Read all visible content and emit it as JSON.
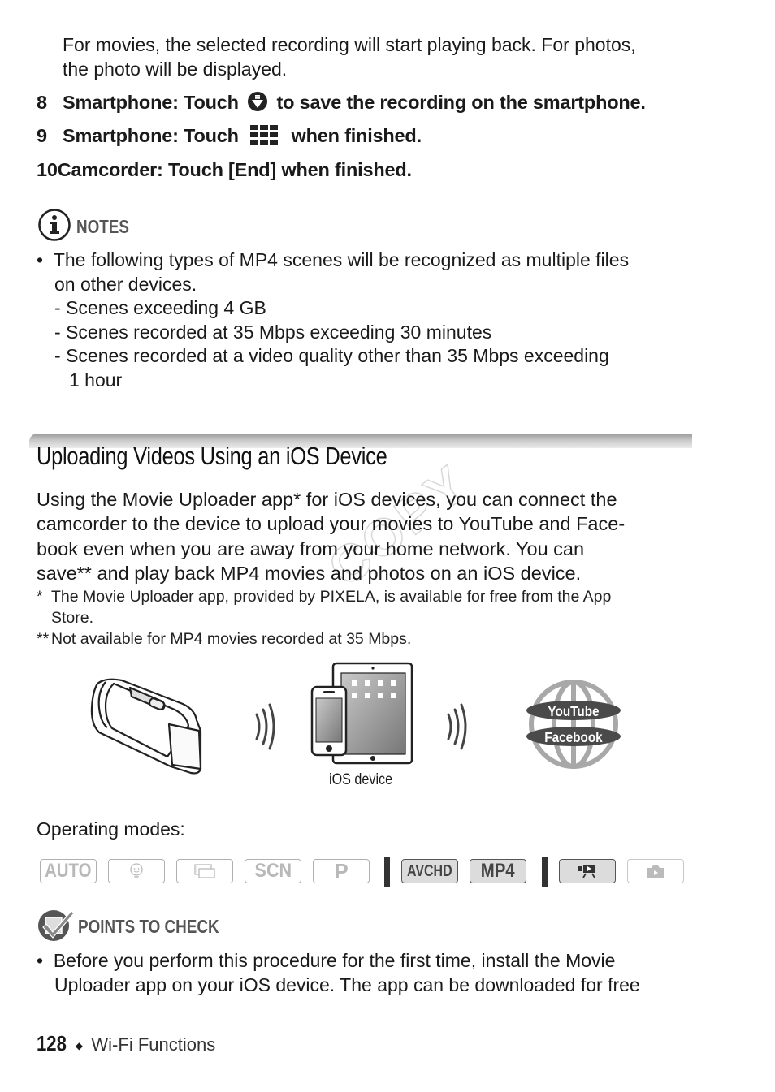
{
  "intro": {
    "line1": "For movies, the selected recording will start playing back. For photos,",
    "line2": "the photo will be displayed."
  },
  "steps": [
    {
      "num": "8",
      "before": "Smartphone: Touch",
      "icon": "save-download-icon",
      "after": "to save the recording on the smartphone."
    },
    {
      "num": "9",
      "before": "Smartphone: Touch",
      "icon": "grid-menu-icon",
      "after": "when finished."
    },
    {
      "num": "10",
      "before": "Camcorder: Touch [End] when finished.",
      "icon": "",
      "after": ""
    }
  ],
  "notes": {
    "heading": "NOTES",
    "bullet": "The following types of MP4 scenes will be recognized as multiple files",
    "bullet_cont": "on other devices.",
    "subitems": [
      "Scenes exceeding 4 GB",
      "Scenes recorded at 35 Mbps exceeding 30 minutes",
      "Scenes recorded at a video quality other than 35 Mbps exceeding"
    ],
    "subitem_cont": "1 hour"
  },
  "section": {
    "title": "Uploading Videos Using an iOS Device",
    "paragraph": [
      "Using the Movie Uploader app* for iOS devices, you can connect the",
      "camcorder to the device to upload your movies to YouTube and Face-",
      "book even when you are away from your home network. You can",
      "save** and play back MP4 movies and photos on an iOS device."
    ],
    "footnotes": [
      {
        "mark": "*",
        "text": "The Movie Uploader app, provided by PIXELA, is available for free from the App",
        "cont": "Store."
      },
      {
        "mark": "**",
        "text": "Not available for MP4 movies recorded at 35 Mbps.",
        "cont": ""
      }
    ],
    "watermark": "COPY"
  },
  "illustration": {
    "ios_label": "iOS device",
    "service1": "YouTube",
    "service2": "Facebook"
  },
  "operating_modes": {
    "label": "Operating modes:",
    "modes": [
      {
        "name": "AUTO",
        "active": false
      },
      {
        "name": "baby-mode",
        "active": false
      },
      {
        "name": "cinema-mode",
        "active": false
      },
      {
        "name": "SCN",
        "active": false
      },
      {
        "name": "P",
        "active": false
      },
      {
        "name": "AVCHD",
        "active": true
      },
      {
        "name": "MP4",
        "active": true
      },
      {
        "name": "movie-playback",
        "active": true
      },
      {
        "name": "photo-playback",
        "active": false
      }
    ]
  },
  "points_to_check": {
    "heading": "POINTS TO CHECK",
    "bullet_line1": "Before you perform this procedure for the first time, install the Movie",
    "bullet_line2": "Uploader app on your iOS device. The app can be downloaded for free"
  },
  "footer": {
    "page_number": "128",
    "separator": "◆",
    "section": "Wi-Fi Functions"
  },
  "colors": {
    "text": "#1a1a1a",
    "heading_gray": "#555555",
    "mode_active_fill": "#dcdcdc",
    "mode_inactive": "#b8b8b8"
  }
}
